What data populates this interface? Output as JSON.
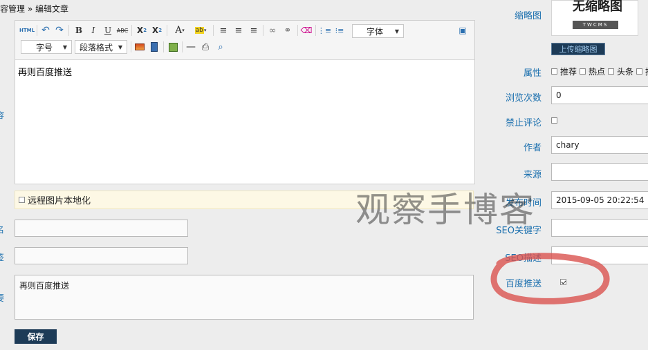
{
  "breadcrumb": {
    "parent": "内容管理",
    "separator": "»",
    "current": "编辑文章"
  },
  "left_labels": {
    "content": "容",
    "alias": "名",
    "tags": "签",
    "summary": "要"
  },
  "editor": {
    "html_label": "HTML",
    "font_select": "字体",
    "size_select": "字号",
    "paragraph_select": "段落格式",
    "body_text": "再则百度推送"
  },
  "remote_images": {
    "label": "远程图片本地化",
    "checked": false
  },
  "fields": {
    "alias_value": "",
    "tags_value": "",
    "summary_text": "再则百度推送"
  },
  "save_label": "保存",
  "right": {
    "thumbnail_label": "缩略图",
    "thumbnail_text": "无缩略图",
    "thumbnail_brand": "TWCMS",
    "upload_label": "上传缩略图",
    "attributes_label": "属性",
    "attributes": [
      "推荐",
      "热点",
      "头条",
      "推"
    ],
    "views_label": "浏览次数",
    "views_value": "0",
    "disable_comment_label": "禁止评论",
    "author_label": "作者",
    "author_value": "chary",
    "source_label": "来源",
    "source_value": "",
    "publish_label": "发布时间",
    "publish_value": "2015-09-05 20:22:54",
    "seo_keywords_label": "SEO关键字",
    "seo_desc_label": "SEO描述",
    "baidu_push_label": "百度推送",
    "baidu_push_checked": true
  },
  "watermark": "观察手博客",
  "colors": {
    "accent": "#1a6fae",
    "button": "#1d3b57",
    "annotation": "#d9534f"
  },
  "icons": [
    "html-icon",
    "undo-icon",
    "redo-icon",
    "bold-icon",
    "italic-icon",
    "underline-icon",
    "strikethrough-icon",
    "superscript-icon",
    "subscript-icon",
    "font-color-icon",
    "highlight-icon",
    "align-left-icon",
    "align-center-icon",
    "align-right-icon",
    "link-icon",
    "unlink-icon",
    "eraser-icon",
    "ordered-list-icon",
    "unordered-list-icon",
    "preview-icon",
    "image-icon",
    "video-icon",
    "map-icon",
    "horizontal-rule-icon",
    "print-icon",
    "search-replace-icon"
  ]
}
